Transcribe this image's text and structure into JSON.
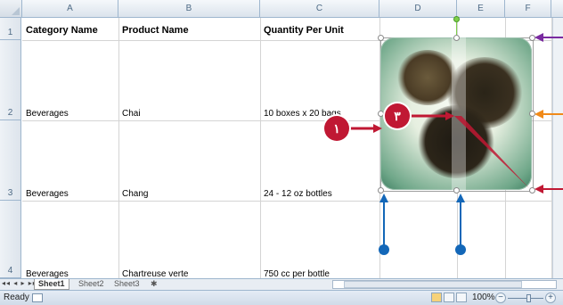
{
  "columns": [
    "A",
    "B",
    "C",
    "D",
    "E",
    "F"
  ],
  "rows": [
    "1",
    "2",
    "3",
    "4"
  ],
  "cells": {
    "a1": "Category Name",
    "b1": "Product Name",
    "c1": "Quantity Per Unit",
    "a2": "Beverages",
    "b2": "Chai",
    "c2": "10 boxes x 20 bags",
    "a3": "Beverages",
    "b3": "Chang",
    "c3": "24 - 12 oz bottles",
    "a4": "Beverages",
    "b4": "Chartreuse verte",
    "c4": "750 cc per bottle"
  },
  "callouts": {
    "one": "١",
    "three": "٣"
  },
  "sheet_tabs": [
    "Sheet1",
    "Sheet2",
    "Sheet3"
  ],
  "tab_nav": "◂◂ ◂ ▸ ▸▸",
  "status": {
    "mode": "Ready",
    "zoom": "100%",
    "zoom_out": "−",
    "zoom_in": "+"
  },
  "colors": {
    "callout_red": "#c01833",
    "callout_blue": "#1367b8",
    "arrow_orange": "#f08a1a",
    "arrow_purple": "#7a2aa0"
  }
}
